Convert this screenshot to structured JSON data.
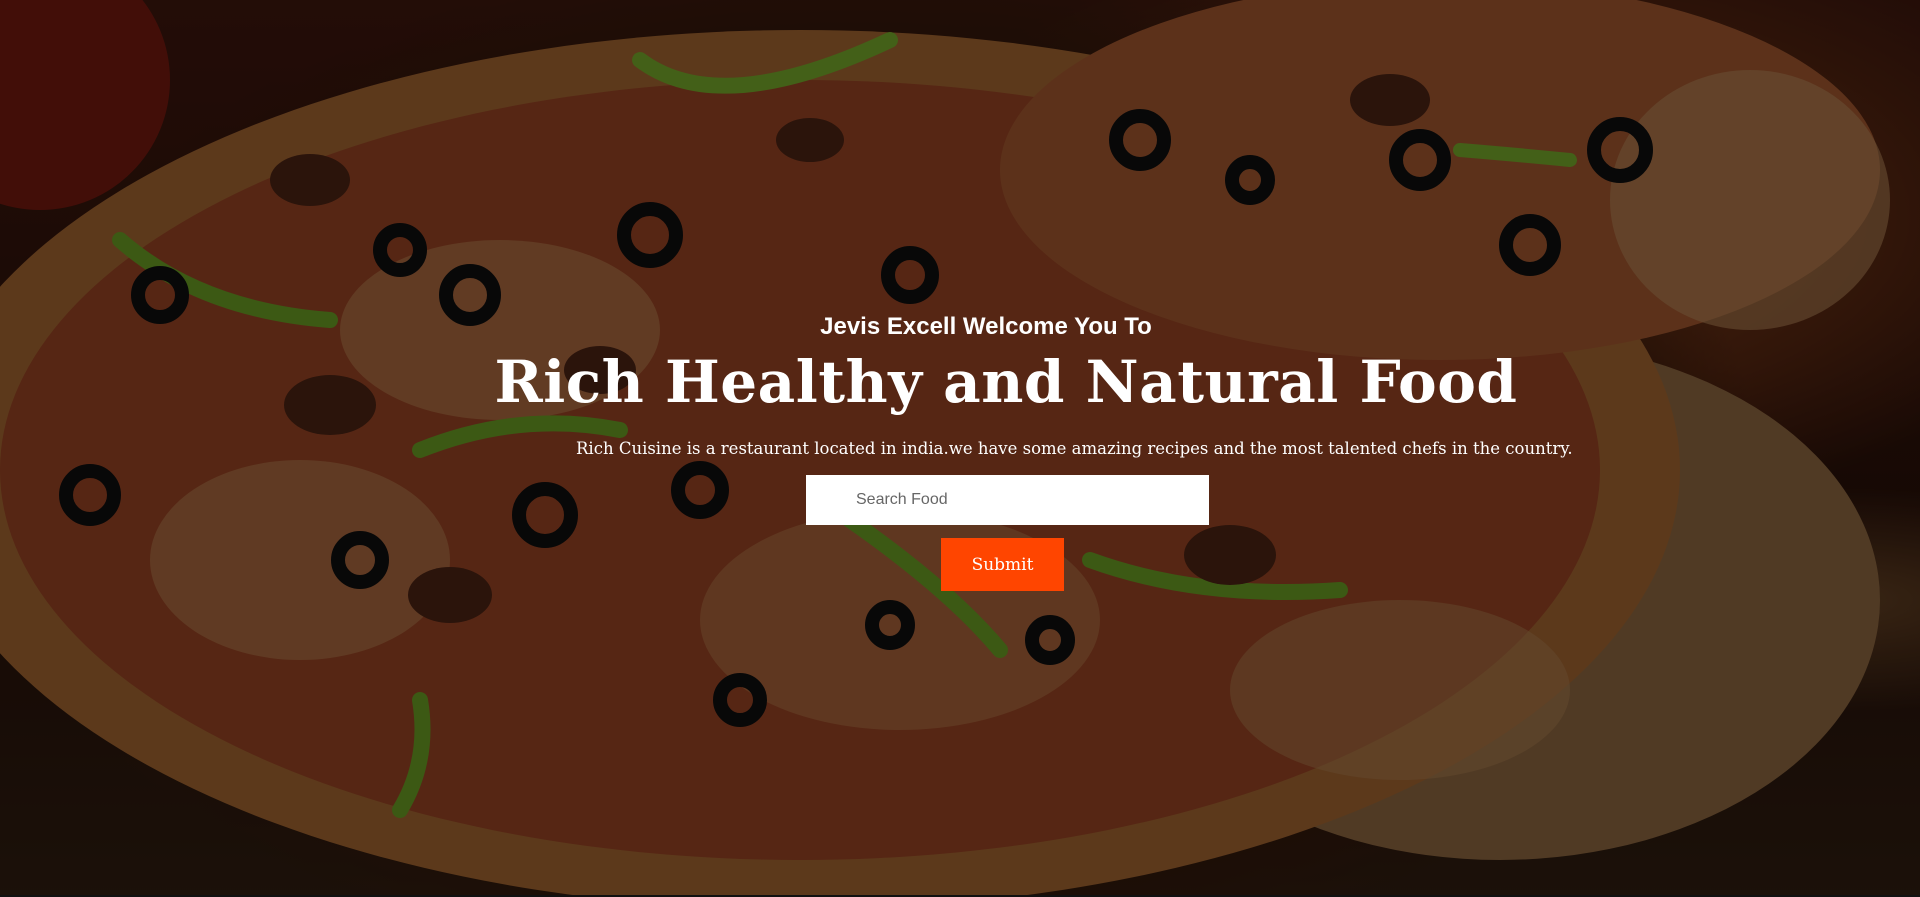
{
  "hero": {
    "eyebrow": "Jevis Excell Welcome You To",
    "headline": "Rich Healthy and Natural Food",
    "tagline": "Rich Cuisine is a restaurant located in india.we have some amazing recipes and the most talented chefs in the country."
  },
  "search": {
    "placeholder": "Search Food",
    "value": ""
  },
  "submit": {
    "label": "Submit"
  },
  "colors": {
    "accent": "#ff4500",
    "text": "#ffffff"
  }
}
